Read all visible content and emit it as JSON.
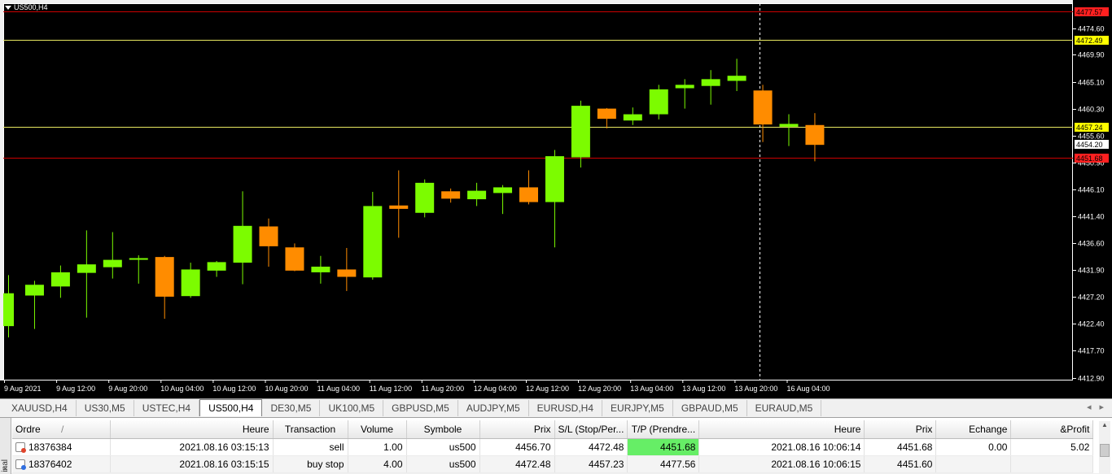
{
  "window": {
    "symbol_label": "US500,H4"
  },
  "colors": {
    "bull": "#7cfc00",
    "bear": "#ff8c00",
    "sl_line": "#cc0000",
    "tp_line": "#e8e860",
    "bg": "#000000",
    "axis_text": "#ffffff",
    "grid_frame": "#ffffff"
  },
  "price_axis": {
    "ticks": [
      "4474.60",
      "4469.90",
      "4465.10",
      "4460.30",
      "4455.60",
      "4450.90",
      "4446.10",
      "4441.40",
      "4436.60",
      "4431.90",
      "4427.20",
      "4422.40",
      "4417.70",
      "4412.90"
    ],
    "tick_values": [
      4474.6,
      4469.9,
      4465.1,
      4460.3,
      4455.6,
      4450.9,
      4446.1,
      4441.4,
      4436.6,
      4431.9,
      4427.2,
      4422.4,
      4417.7,
      4412.9
    ],
    "range": [
      4412.4,
      4479.0
    ]
  },
  "price_labels": [
    {
      "text": "4477.57",
      "value": 4477.57,
      "bg": "#ff2020",
      "fg": "#000000",
      "line": "#cc0000"
    },
    {
      "text": "4472.49",
      "value": 4472.49,
      "bg": "#ffff00",
      "fg": "#000000",
      "line": "#e8e860"
    },
    {
      "text": "4457.24",
      "value": 4457.24,
      "bg": "#ffff00",
      "fg": "#000000",
      "line": "#e8e860"
    },
    {
      "text": "4454.20",
      "value": 4454.2,
      "bg": "#ffffff",
      "fg": "#000000",
      "line": ""
    },
    {
      "text": "4451.68",
      "value": 4451.68,
      "bg": "#ff2020",
      "fg": "#000000",
      "line": "#cc0000"
    }
  ],
  "time_axis": [
    "9 Aug 2021",
    "9 Aug 12:00",
    "9 Aug 20:00",
    "10 Aug 04:00",
    "10 Aug 12:00",
    "10 Aug 20:00",
    "11 Aug 04:00",
    "11 Aug 12:00",
    "11 Aug 20:00",
    "12 Aug 04:00",
    "12 Aug 12:00",
    "12 Aug 20:00",
    "13 Aug 04:00",
    "13 Aug 12:00",
    "13 Aug 20:00",
    "16 Aug 04:00"
  ],
  "chart_data": {
    "type": "candlestick",
    "candles": [
      {
        "o": 4422.0,
        "h": 4431.0,
        "l": 4420.0,
        "c": 4427.8
      },
      {
        "o": 4427.4,
        "h": 4430.0,
        "l": 4421.5,
        "c": 4429.3
      },
      {
        "o": 4429.0,
        "h": 4432.7,
        "l": 4427.0,
        "c": 4431.5
      },
      {
        "o": 4431.4,
        "h": 4438.9,
        "l": 4423.5,
        "c": 4432.9
      },
      {
        "o": 4432.4,
        "h": 4438.6,
        "l": 4430.4,
        "c": 4433.7
      },
      {
        "o": 4433.9,
        "h": 4434.5,
        "l": 4429.5,
        "c": 4434.0
      },
      {
        "o": 4434.2,
        "h": 4434.4,
        "l": 4423.3,
        "c": 4427.2
      },
      {
        "o": 4427.3,
        "h": 4433.2,
        "l": 4427.0,
        "c": 4432.0
      },
      {
        "o": 4431.8,
        "h": 4433.5,
        "l": 4430.7,
        "c": 4433.3
      },
      {
        "o": 4433.2,
        "h": 4445.8,
        "l": 4429.4,
        "c": 4439.7
      },
      {
        "o": 4439.6,
        "h": 4441.0,
        "l": 4432.5,
        "c": 4436.1
      },
      {
        "o": 4435.9,
        "h": 4436.6,
        "l": 4431.7,
        "c": 4431.8
      },
      {
        "o": 4431.5,
        "h": 4434.4,
        "l": 4429.5,
        "c": 4432.5
      },
      {
        "o": 4432.0,
        "h": 4435.8,
        "l": 4428.2,
        "c": 4430.7
      },
      {
        "o": 4430.6,
        "h": 4445.7,
        "l": 4430.2,
        "c": 4443.2
      },
      {
        "o": 4443.3,
        "h": 4449.5,
        "l": 4437.6,
        "c": 4442.7
      },
      {
        "o": 4442.0,
        "h": 4447.9,
        "l": 4441.2,
        "c": 4447.3
      },
      {
        "o": 4445.8,
        "h": 4446.3,
        "l": 4443.8,
        "c": 4444.5
      },
      {
        "o": 4444.4,
        "h": 4447.3,
        "l": 4443.2,
        "c": 4445.9
      },
      {
        "o": 4445.5,
        "h": 4446.9,
        "l": 4441.8,
        "c": 4446.5
      },
      {
        "o": 4446.5,
        "h": 4449.5,
        "l": 4443.5,
        "c": 4443.9
      },
      {
        "o": 4443.9,
        "h": 4453.1,
        "l": 4435.9,
        "c": 4452.0
      },
      {
        "o": 4451.8,
        "h": 4461.8,
        "l": 4450.0,
        "c": 4460.9
      },
      {
        "o": 4460.4,
        "h": 4460.5,
        "l": 4456.9,
        "c": 4458.6
      },
      {
        "o": 4458.3,
        "h": 4460.6,
        "l": 4457.5,
        "c": 4459.4
      },
      {
        "o": 4459.4,
        "h": 4464.6,
        "l": 4458.5,
        "c": 4463.8
      },
      {
        "o": 4464.0,
        "h": 4465.6,
        "l": 4460.4,
        "c": 4464.6
      },
      {
        "o": 4464.4,
        "h": 4467.2,
        "l": 4461.1,
        "c": 4465.6
      },
      {
        "o": 4465.3,
        "h": 4469.2,
        "l": 4463.5,
        "c": 4466.2
      },
      {
        "o": 4463.6,
        "h": 4464.6,
        "l": 4454.5,
        "c": 4457.6
      },
      {
        "o": 4457.2,
        "h": 4459.4,
        "l": 4453.8,
        "c": 4457.7
      },
      {
        "o": 4457.5,
        "h": 4459.6,
        "l": 4451.1,
        "c": 4454.0
      }
    ]
  },
  "tabs": [
    {
      "label": "XAUUSD,H4",
      "active": false
    },
    {
      "label": "US30,M5",
      "active": false
    },
    {
      "label": "USTEC,H4",
      "active": false
    },
    {
      "label": "US500,H4",
      "active": true
    },
    {
      "label": "DE30,M5",
      "active": false
    },
    {
      "label": "UK100,M5",
      "active": false
    },
    {
      "label": "GBPUSD,M5",
      "active": false
    },
    {
      "label": "AUDJPY,M5",
      "active": false
    },
    {
      "label": "EURUSD,H4",
      "active": false
    },
    {
      "label": "EURJPY,M5",
      "active": false
    },
    {
      "label": "GBPAUD,M5",
      "active": false
    },
    {
      "label": "EURAUD,M5",
      "active": false
    }
  ],
  "tab_nav": {
    "prev": "◂",
    "next": "▸"
  },
  "terminal": {
    "side_label": "inal",
    "close": "×",
    "columns": {
      "ordre": "Ordre",
      "sort": "/",
      "heure": "Heure",
      "transaction": "Transaction",
      "volume": "Volume",
      "symbole": "Symbole",
      "prix": "Prix",
      "sl": "S/L (Stop/Per...",
      "tp": "T/P (Prendre...",
      "heure2": "Heure",
      "prix2": "Prix",
      "echange": "Echange",
      "profit": "&Profit"
    },
    "rows": [
      {
        "ordre": "18376384",
        "heure": "2021.08.16 03:15:13",
        "transaction": "sell",
        "volume": "1.00",
        "symbole": "us500",
        "prix": "4456.70",
        "sl": "4472.48",
        "tp": "4451.68",
        "heure2": "2021.08.16 10:06:14",
        "prix2": "4451.68",
        "echange": "0.00",
        "profit": "5.02"
      },
      {
        "ordre": "18376402",
        "heure": "2021.08.16 03:15:15",
        "transaction": "buy stop",
        "volume": "4.00",
        "symbole": "us500",
        "prix": "4472.48",
        "sl": "4457.23",
        "tp": "4477.56",
        "heure2": "2021.08.16 10:06:15",
        "prix2": "4451.60",
        "echange": "",
        "profit": ""
      }
    ]
  }
}
